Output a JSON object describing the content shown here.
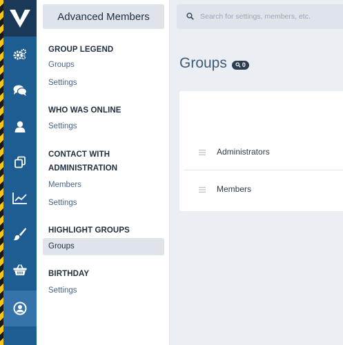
{
  "rail": {
    "items": [
      {
        "icon": "gears-icon"
      },
      {
        "icon": "chat-icon"
      },
      {
        "icon": "user-icon"
      },
      {
        "icon": "copy-icon"
      },
      {
        "icon": "chart-icon"
      },
      {
        "icon": "brush-icon"
      },
      {
        "icon": "basket-icon"
      },
      {
        "icon": "user-circle-icon",
        "active": true
      }
    ]
  },
  "subnav": {
    "title": "Advanced Members",
    "sections": [
      {
        "heading": "GROUP LEGEND",
        "links": [
          "Groups",
          "Settings"
        ]
      },
      {
        "heading": "WHO WAS ONLINE",
        "links": [
          "Settings"
        ]
      },
      {
        "heading_line1": "CONTACT WITH",
        "heading_line2": "ADMINISTRATION",
        "links": [
          "Members",
          "Settings"
        ]
      },
      {
        "heading": "HIGHLIGHT GROUPS",
        "links": [
          "Groups"
        ]
      },
      {
        "heading": "BIRTHDAY",
        "links": [
          "Settings"
        ]
      }
    ]
  },
  "search": {
    "placeholder": "Search for settings, members, etc."
  },
  "main": {
    "title": "Groups",
    "count": "0",
    "rows": [
      "Administrators",
      "Members"
    ]
  },
  "colors": {
    "rail": "#1e5d92",
    "rail_active": "#3673ab",
    "accent_title": "#3d5a78"
  }
}
